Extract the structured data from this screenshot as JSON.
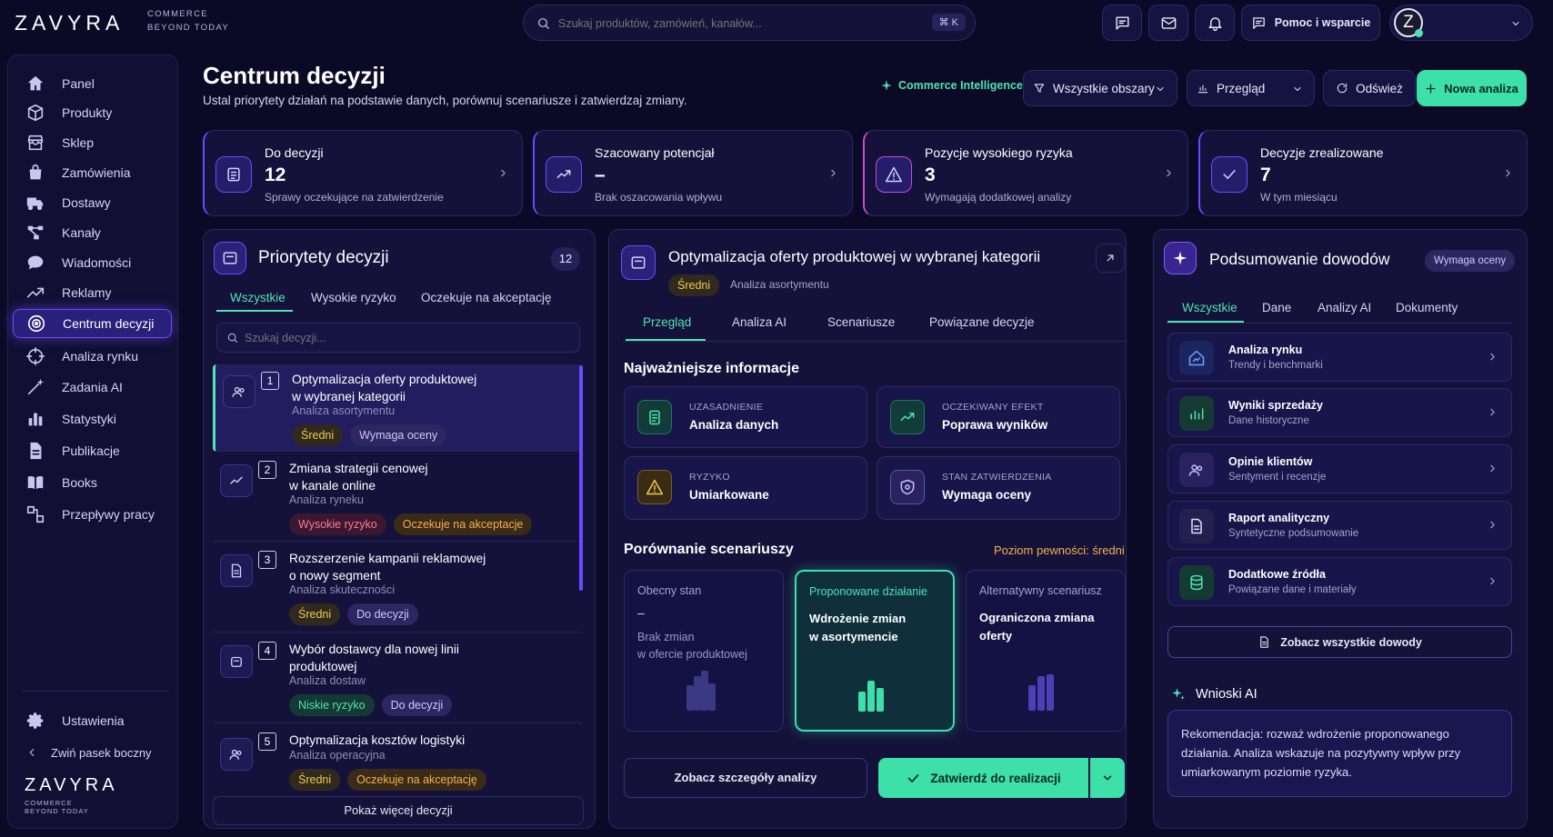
{
  "brand": {
    "name": "ZAVYRA",
    "tagline1": "COMMERCE",
    "tagline2": "BEYOND TODAY"
  },
  "search": {
    "placeholder": "Szukaj produktów, zamówień, kanałów...",
    "shortcut": "⌘ K"
  },
  "topbar": {
    "help_label": "Pomoc i wsparcie",
    "avatar_letter": "Z"
  },
  "sidebar": {
    "items": [
      {
        "label": "Panel",
        "icon": "home-icon"
      },
      {
        "label": "Produkty",
        "icon": "box-icon"
      },
      {
        "label": "Sklep",
        "icon": "store-icon"
      },
      {
        "label": "Zamówienia",
        "icon": "bag-icon"
      },
      {
        "label": "Dostawy",
        "icon": "truck-icon"
      },
      {
        "label": "Kanały",
        "icon": "channels-icon"
      },
      {
        "label": "Wiadomości",
        "icon": "chat-icon"
      },
      {
        "label": "Reklamy",
        "icon": "trend-icon"
      },
      {
        "label": "Centrum decyzji",
        "icon": "target-icon",
        "active": true
      },
      {
        "label": "Analiza rynku",
        "icon": "crosshair-icon"
      },
      {
        "label": "Zadania AI",
        "icon": "wand-icon"
      },
      {
        "label": "Statystyki",
        "icon": "bars-icon"
      },
      {
        "label": "Publikacje",
        "icon": "document-icon"
      },
      {
        "label": "Books",
        "icon": "book-icon"
      },
      {
        "label": "Przepływy pracy",
        "icon": "workflow-icon"
      }
    ],
    "settings_label": "Ustawienia",
    "collapse_label": "Zwiń pasek boczny"
  },
  "header": {
    "title": "Centrum decyzji",
    "subtitle": "Ustal priorytety działań na podstawie danych, porównuj scenariusze i zatwierdzaj zmiany.",
    "ci_label": "Commerce Intelligence",
    "filter_label": "Wszystkie obszary",
    "view_label": "Przegląd",
    "refresh_label": "Odśwież",
    "new_label": "Nowa analiza"
  },
  "kpis": [
    {
      "title": "Do decyzji",
      "value": "12",
      "sub": "Sprawy oczekujące na zatwierdzenie"
    },
    {
      "title": "Szacowany potencjał",
      "value": "–",
      "sub": "Brak oszacowania wpływu"
    },
    {
      "title": "Pozycje wysokiego ryzyka",
      "value": "3",
      "sub": "Wymagają dodatkowej analizy"
    },
    {
      "title": "Decyzje zrealizowane",
      "value": "7",
      "sub": "W tym miesiącu"
    }
  ],
  "priorities": {
    "title": "Priorytety decyzji",
    "count": "12",
    "tabs": [
      "Wszystkie",
      "Wysokie ryzyko",
      "Oczekuje na akceptację"
    ],
    "search_placeholder": "Szukaj decyzji...",
    "items": [
      {
        "n": "1",
        "line1": "Optymalizacja oferty produktowej",
        "line2": "w wybranej kategorii",
        "sub": "Analiza asortymentu",
        "tags": [
          "Średni",
          "Wymaga oceny"
        ]
      },
      {
        "n": "2",
        "line1": "Zmiana strategii cenowej",
        "line2": "w kanale online",
        "sub": "Analiza ryneku",
        "tags": [
          "Wysokie ryzyko",
          "Oczekuje na akceptacje"
        ]
      },
      {
        "n": "3",
        "line1": "Rozszerzenie kampanii reklamowej",
        "line2": "o nowy segment",
        "sub": "Analiza skuteczności",
        "tags": [
          "Średni",
          "Do decyzji"
        ]
      },
      {
        "n": "4",
        "line1": "Wybór dostawcy dla nowej linii",
        "line2": "produktowej",
        "sub": "Analiza dostaw",
        "tags": [
          "Niskie ryzyko",
          "Do decyzji"
        ]
      },
      {
        "n": "5",
        "line1": "Optymalizacja kosztów logistyki",
        "line2": "",
        "sub": "Analiza operacyjna",
        "tags": [
          "Średni",
          "Oczekuje na akceptację"
        ]
      }
    ],
    "more_label": "Pokaż więcej decyzji"
  },
  "detail": {
    "title": "Optymalizacja oferty produktowej w wybranej kategorii",
    "tag": "Średni",
    "category": "Analiza asortymentu",
    "tabs": [
      "Przegląd",
      "Analiza AI",
      "Scenariusze",
      "Powiązane decyzje"
    ],
    "key_title": "Najważniejsze informacje",
    "info": [
      {
        "label": "UZASADNIENIE",
        "value": "Analiza danych"
      },
      {
        "label": "OCZEKIWANY EFEKT",
        "value": "Poprawa wyników"
      },
      {
        "label": "RYZYKO",
        "value": "Umiarkowane"
      },
      {
        "label": "STAN ZATWIERDZENIA",
        "value": "Wymaga oceny"
      }
    ],
    "compare_title": "Porównanie scenariuszy",
    "confidence": "Poziom pewności: średni",
    "scenarios": [
      {
        "title": "Obecny stan",
        "value": "–",
        "desc1": "Brak zmian",
        "desc2": "w ofercie produktowej"
      },
      {
        "title": "Proponowane działanie",
        "value": "Wdrożenie zmian",
        "desc1": "w asortymencie",
        "desc2": ""
      },
      {
        "title": "Alternatywny scenariusz",
        "value": "Ograniczona zmiana",
        "desc1": "oferty",
        "desc2": ""
      }
    ],
    "details_btn": "Zobacz szczegóły analizy",
    "approve_btn": "Zatwierdź do realizacji"
  },
  "evidence": {
    "title": "Podsumowanie dowodów",
    "badge": "Wymaga oceny",
    "tabs": [
      "Wszystkie",
      "Dane",
      "Analizy AI",
      "Dokumenty"
    ],
    "items": [
      {
        "title": "Analiza rynku",
        "sub": "Trendy i benchmarki"
      },
      {
        "title": "Wyniki sprzedaży",
        "sub": "Dane historyczne"
      },
      {
        "title": "Opinie klientów",
        "sub": "Sentyment i recenzje"
      },
      {
        "title": "Raport analityczny",
        "sub": "Syntetyczne podsumowanie"
      },
      {
        "title": "Dodatkowe źródła",
        "sub": "Powiązane dane i materiały"
      }
    ],
    "all_btn": "Zobacz wszystkie dowody",
    "ai_title": "Wnioski AI",
    "ai_text": "Rekomendacja: rozważ wdrożenie proponowanego działania. Analiza wskazuje na pozytywny wpływ przy umiarkowanym poziomie ryzyka."
  },
  "colors": {
    "accent": "#4ee3b0",
    "purple": "#6a4bff",
    "bg": "#0b0a26"
  }
}
